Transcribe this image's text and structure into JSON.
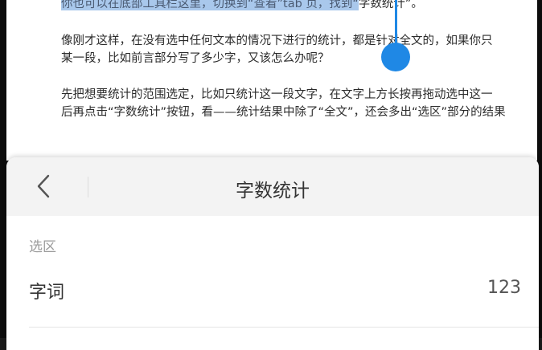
{
  "document": {
    "paragraph1_selected": "你也可以在底部工具栏这里，切换到“查看”tab 页，找到“",
    "paragraph1_rest": "字数统计”。",
    "paragraph2_line1": "像刚才这样，在没有选中任何文本的情况下进行的统计，都是针对全文的，如果你只",
    "paragraph2_line2": "某一段，比如前言部分写了多少字，又该怎么办呢？",
    "paragraph3_line1": "先把想要统计的范围选定，比如只统计这一段文字，在文字上方长按再拖动选中这一",
    "paragraph3_line2": "后再点击“字数统计”按钮，看——统计结果中除了“全文”，还会多出“选区”部分的结果"
  },
  "sheet": {
    "title": "字数统计",
    "section_label": "选区",
    "rows": [
      {
        "label": "字词",
        "value": "123"
      }
    ]
  },
  "colors": {
    "selection": "#a9c8ec",
    "cursor": "#1f88e5"
  },
  "icons": {
    "back": "chevron-left-icon"
  }
}
